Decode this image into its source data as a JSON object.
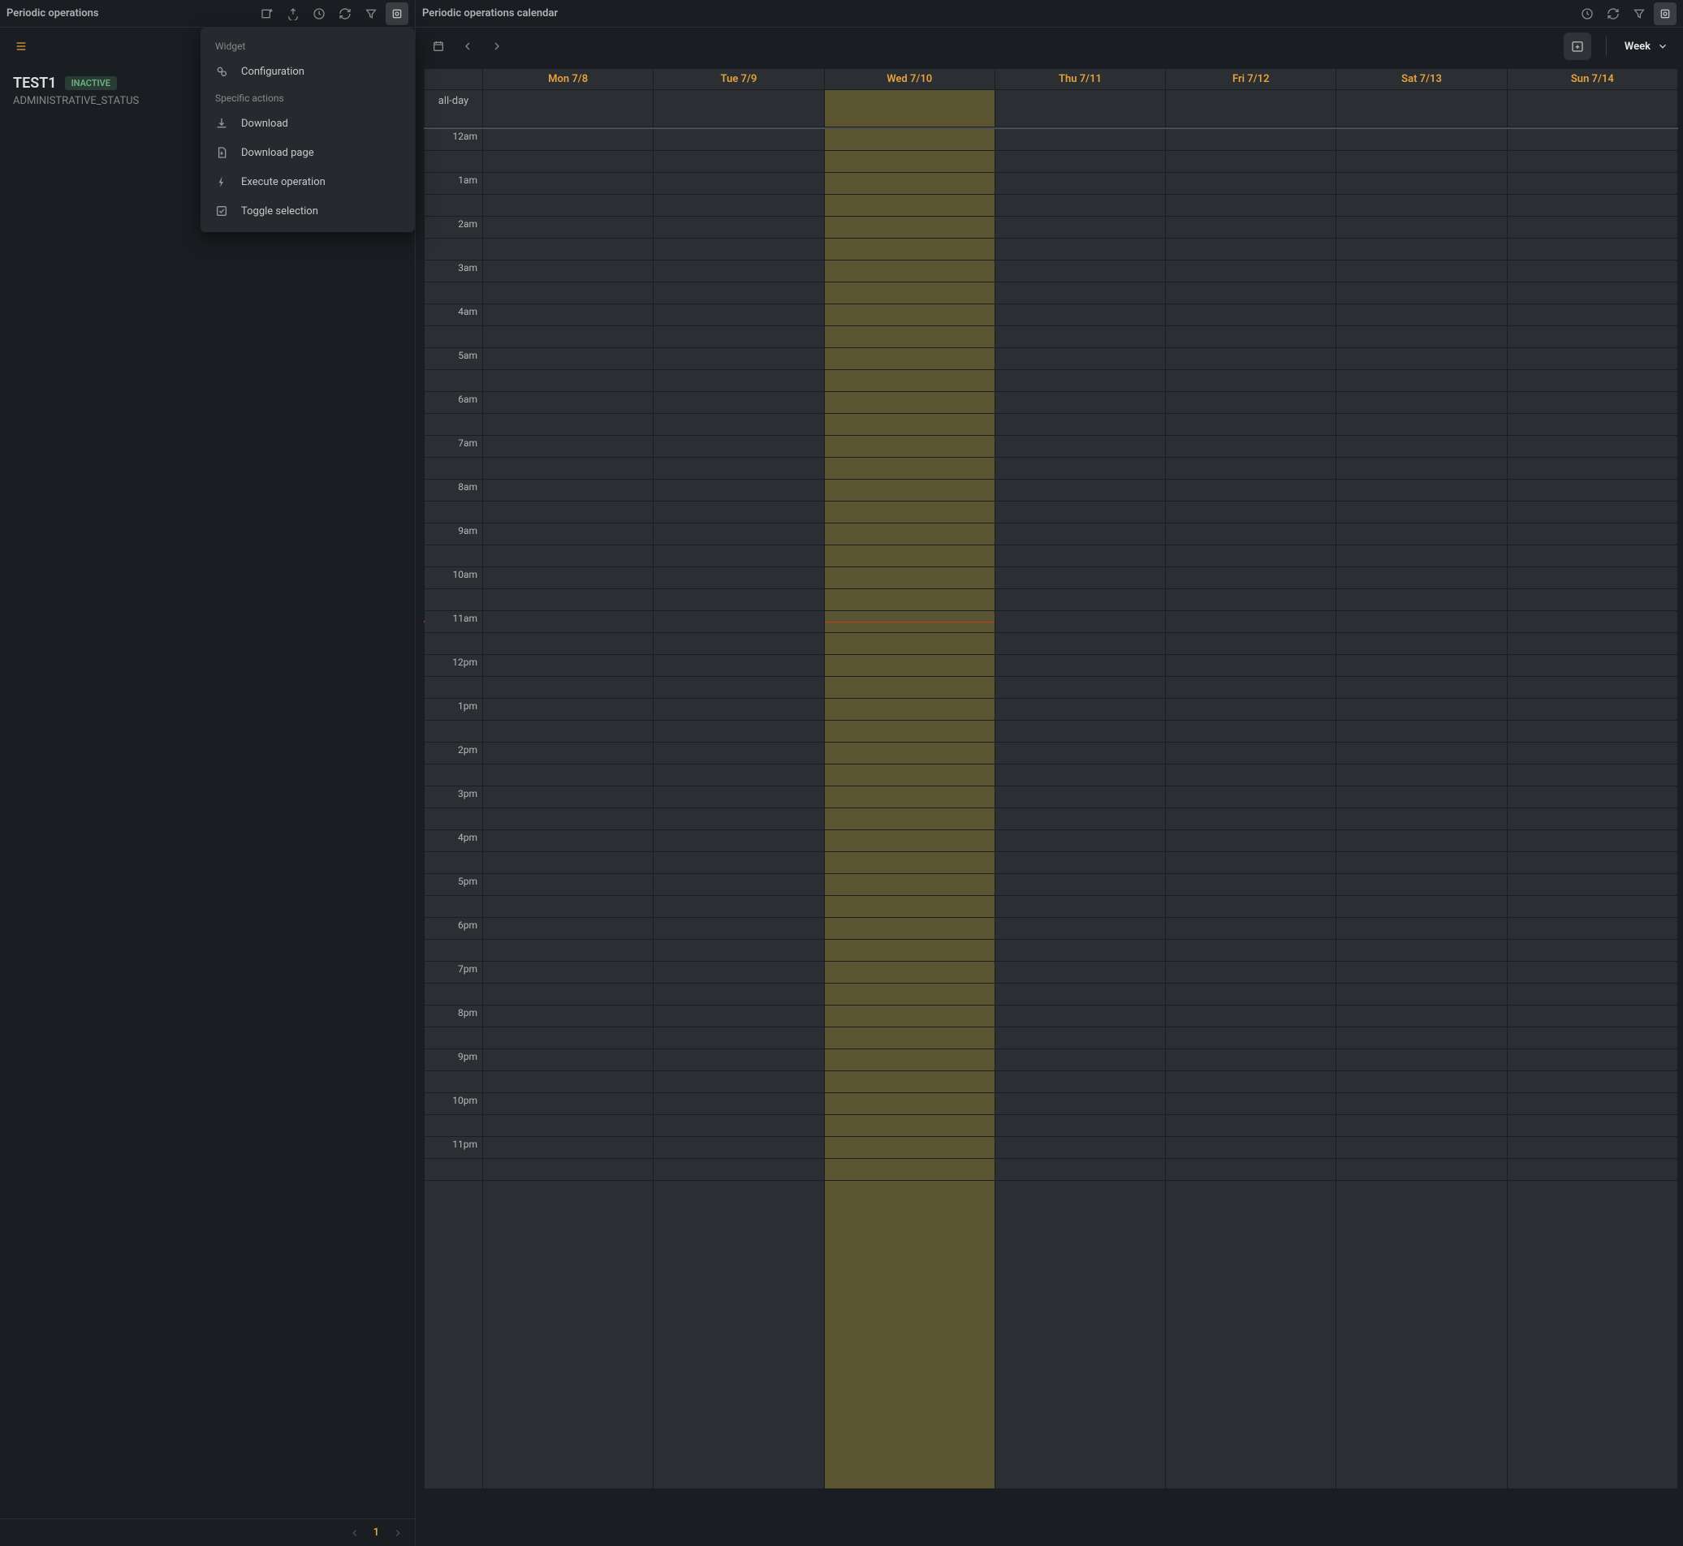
{
  "left_panel": {
    "title": "Periodic operations",
    "item": {
      "name": "TEST1",
      "status_badge": "INACTIVE",
      "subtitle": "ADMINISTRATIVE_STATUS"
    },
    "pagination": {
      "current": "1"
    }
  },
  "dropdown": {
    "section1_label": "Widget",
    "configuration": "Configuration",
    "section2_label": "Specific actions",
    "download": "Download",
    "download_page": "Download page",
    "execute_operation": "Execute operation",
    "toggle_selection": "Toggle selection"
  },
  "right_panel": {
    "title": "Periodic operations calendar",
    "view_label": "Week",
    "all_day_label": "all-day",
    "days": [
      "Mon 7/8",
      "Tue 7/9",
      "Wed 7/10",
      "Thu 7/11",
      "Fri 7/12",
      "Sat 7/13",
      "Sun 7/14"
    ],
    "today_index": 2,
    "hours": [
      "12am",
      "1am",
      "2am",
      "3am",
      "4am",
      "5am",
      "6am",
      "7am",
      "8am",
      "9am",
      "10am",
      "11am",
      "12pm",
      "1pm",
      "2pm",
      "3pm",
      "4pm",
      "5pm",
      "6pm",
      "7pm",
      "8pm",
      "9pm",
      "10pm",
      "11pm"
    ],
    "now_row_index": 22
  }
}
